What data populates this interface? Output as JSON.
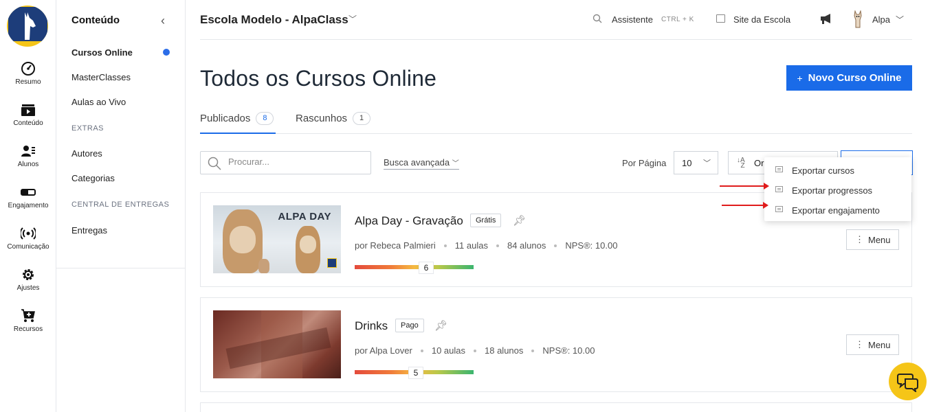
{
  "rail": {
    "items": [
      {
        "label": "Resumo",
        "icon": "gauge-icon"
      },
      {
        "label": "Conteúdo",
        "icon": "play-icon"
      },
      {
        "label": "Alunos",
        "icon": "users-icon"
      },
      {
        "label": "Engajamento",
        "icon": "toggle-icon"
      },
      {
        "label": "Comunicação",
        "icon": "broadcast-icon"
      },
      {
        "label": "Ajustes",
        "icon": "gear-icon"
      },
      {
        "label": "Recursos",
        "icon": "cart-icon"
      }
    ]
  },
  "sidebar": {
    "title": "Conteúdo",
    "items": [
      "Cursos Online",
      "MasterClasses",
      "Aulas ao Vivo"
    ],
    "section_extras": "EXTRAS",
    "extras": [
      "Autores",
      "Categorias"
    ],
    "section_central": "CENTRAL DE ENTREGAS",
    "central": [
      "Entregas"
    ]
  },
  "topbar": {
    "school": "Escola Modelo - AlpaClass",
    "assistant": "Assistente",
    "shortcut": "CTRL + K",
    "site": "Site da Escola",
    "user": "Alpa"
  },
  "page": {
    "title": "Todos os Cursos Online",
    "new_button": "Novo Curso Online"
  },
  "tabs": [
    {
      "label": "Publicados",
      "count": "8"
    },
    {
      "label": "Rascunhos",
      "count": "1"
    }
  ],
  "filters": {
    "search_placeholder": "Procurar...",
    "advanced": "Busca avançada",
    "per_page_label": "Por Página",
    "per_page_value": "10",
    "order_label": "Or"
  },
  "export_menu": [
    "Exportar cursos",
    "Exportar progressos",
    "Exportar engajamento"
  ],
  "courses": [
    {
      "title": "Alpa Day - Gravação",
      "badge": "Grátis",
      "thumb_text": "ALPA DAY",
      "author": "por Rebeca Palmieri",
      "lessons": "11 aulas",
      "students": "84 alunos",
      "nps": "NPS®: 10.00",
      "nps_score": "6",
      "menu": "Menu"
    },
    {
      "title": "Drinks",
      "badge": "Pago",
      "author": "por Alpa Lover",
      "lessons": "10 aulas",
      "students": "18 alunos",
      "nps": "NPS®: 10.00",
      "nps_score": "5",
      "menu": "Menu"
    }
  ],
  "colors": {
    "accent": "#1a6be8",
    "brand_yellow": "#f5c518",
    "brand_navy": "#1d3d7a",
    "annotation_red": "#e01b1b"
  }
}
